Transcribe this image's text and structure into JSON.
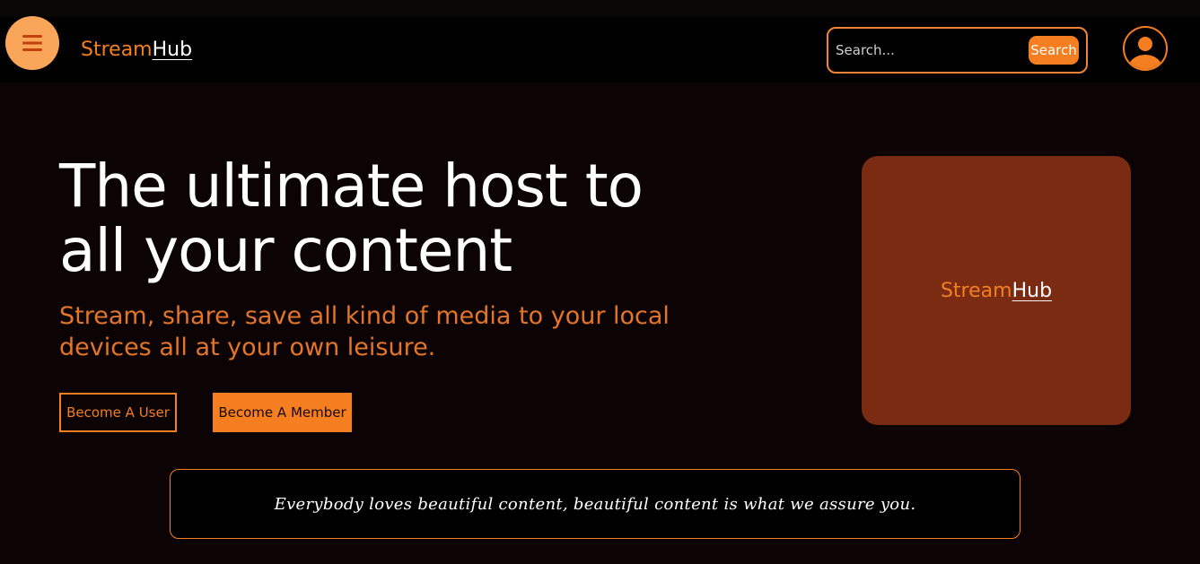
{
  "colors": {
    "accent": "#f47e20",
    "menu_button_bg": "#f9a65a",
    "logo_card_bg": "#7b2b12",
    "page_bg": "#0c0404"
  },
  "header": {
    "menu_icon": "hamburger-menu-icon",
    "brand_part1": "Stream",
    "brand_part2": "Hub",
    "search": {
      "placeholder": "Search...",
      "value": "",
      "button_label": "Search"
    },
    "profile_icon": "user-avatar-icon"
  },
  "hero": {
    "title_line1": "The ultimate host to",
    "title_line2": "all your content",
    "subtitle_line1": "Stream, share, save all kind of media to your local",
    "subtitle_line2": "devices all at your own leisure.",
    "buttons": {
      "become_user": "Become A User",
      "become_member": "Become A Member"
    }
  },
  "logo_card": {
    "brand_part1": "Stream",
    "brand_part2": "Hub"
  },
  "quote": {
    "text": "Everybody loves beautiful content, beautiful content is what we assure you."
  }
}
